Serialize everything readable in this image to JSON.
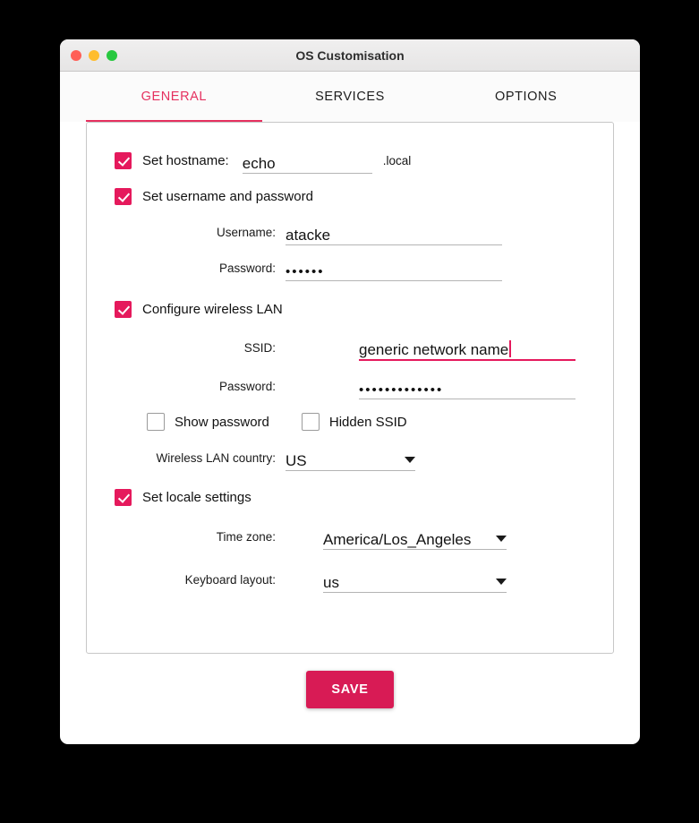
{
  "window": {
    "title": "OS Customisation",
    "traffic_lights": [
      "close-button",
      "minimize-button",
      "maximize-button"
    ]
  },
  "tabs": [
    {
      "label": "GENERAL",
      "active": true
    },
    {
      "label": "SERVICES",
      "active": false
    },
    {
      "label": "OPTIONS",
      "active": false
    }
  ],
  "form": {
    "hostname": {
      "checkbox_label": "Set hostname:",
      "checked": true,
      "value": "echo",
      "suffix": ".local"
    },
    "user": {
      "checkbox_label": "Set username and password",
      "checked": true,
      "username_label": "Username:",
      "username_value": "atacke",
      "password_label": "Password:",
      "password_value": "••••••"
    },
    "wireless": {
      "checkbox_label": "Configure wireless LAN",
      "checked": true,
      "ssid_label": "SSID:",
      "ssid_value": "generic network name",
      "ssid_focused": true,
      "password_label": "Password:",
      "password_value": "•••••••••••••",
      "show_password_label": "Show password",
      "show_password_checked": false,
      "hidden_ssid_label": "Hidden SSID",
      "hidden_ssid_checked": false,
      "country_label": "Wireless LAN country:",
      "country_value": "US"
    },
    "locale": {
      "checkbox_label": "Set locale settings",
      "checked": true,
      "timezone_label": "Time zone:",
      "timezone_value": "America/Los_Angeles",
      "keyboard_label": "Keyboard layout:",
      "keyboard_value": "us"
    }
  },
  "footer": {
    "save_label": "SAVE"
  },
  "colors": {
    "accent": "#e5195c",
    "accent_tab": "#e5305f",
    "save_button": "#d81b55",
    "traffic_red": "#ff5f57",
    "traffic_yellow": "#ffbd2e",
    "traffic_green": "#28c840"
  }
}
